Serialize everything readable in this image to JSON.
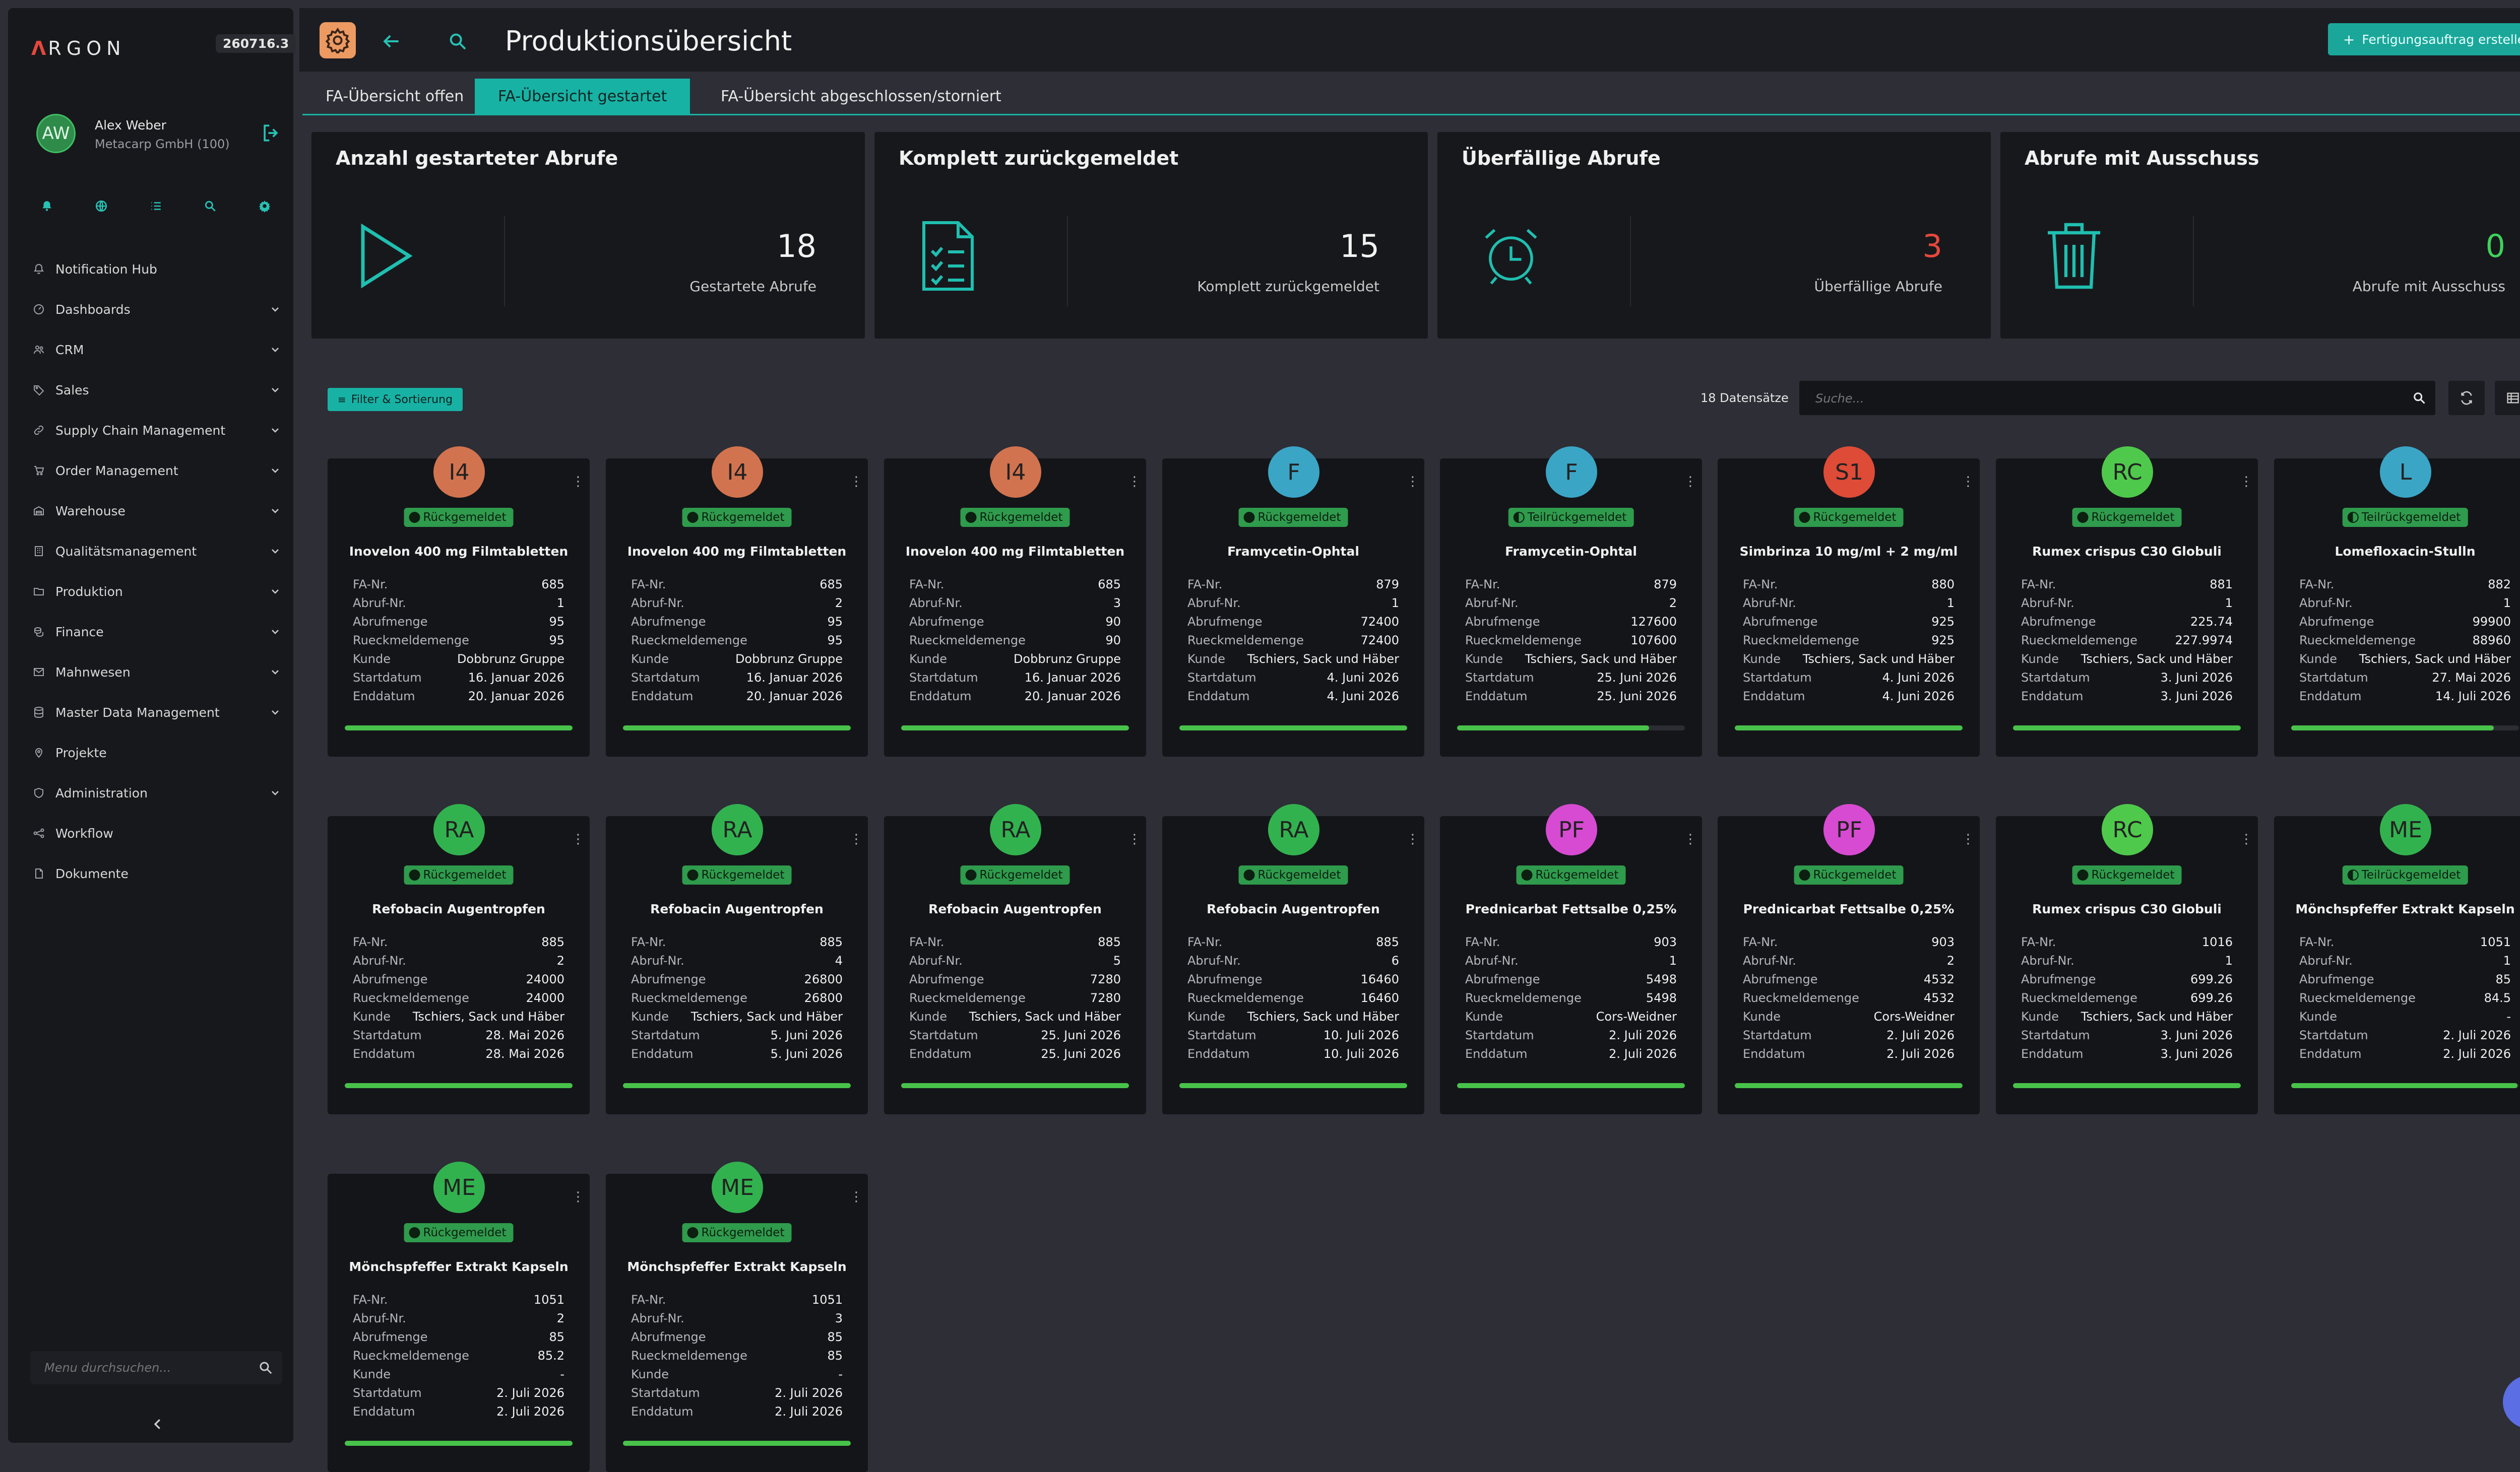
{
  "app": {
    "logo_symbol": "Λ",
    "logo_text": "RGON",
    "version": "260716.3"
  },
  "user": {
    "initials": "AW",
    "name": "Alex Weber",
    "company": "Metacarp GmbH (100)"
  },
  "quick_icons": [
    "bell-icon",
    "globe-icon",
    "list-icon",
    "search-icon",
    "gear-icon"
  ],
  "nav": [
    {
      "label": "Notification Hub",
      "icon": "bell-icon",
      "chevron": false
    },
    {
      "label": "Dashboards",
      "icon": "dashboard-icon",
      "chevron": true
    },
    {
      "label": "CRM",
      "icon": "users-icon",
      "chevron": true
    },
    {
      "label": "Sales",
      "icon": "tag-icon",
      "chevron": true
    },
    {
      "label": "Supply Chain Management",
      "icon": "link-icon",
      "chevron": true
    },
    {
      "label": "Order Management",
      "icon": "cart-icon",
      "chevron": true
    },
    {
      "label": "Warehouse",
      "icon": "warehouse-icon",
      "chevron": true
    },
    {
      "label": "Qualitätsmanagement",
      "icon": "building-icon",
      "chevron": true
    },
    {
      "label": "Produktion",
      "icon": "folder-icon",
      "chevron": true
    },
    {
      "label": "Finance",
      "icon": "coins-icon",
      "chevron": true
    },
    {
      "label": "Mahnwesen",
      "icon": "envelope-icon",
      "chevron": true
    },
    {
      "label": "Master Data Management",
      "icon": "database-icon",
      "chevron": true
    },
    {
      "label": "Projekte",
      "icon": "pin-icon",
      "chevron": false
    },
    {
      "label": "Administration",
      "icon": "shield-icon",
      "chevron": true
    },
    {
      "label": "Workflow",
      "icon": "workflow-icon",
      "chevron": false
    },
    {
      "label": "Dokumente",
      "icon": "document-icon",
      "chevron": false
    }
  ],
  "menu_search": {
    "placeholder": "Menu durchsuchen..."
  },
  "header": {
    "title": "Produktionsübersicht",
    "create_label": "Fertigungsauftrag erstellen"
  },
  "tabs": [
    {
      "label": "FA-Übersicht offen",
      "active": false
    },
    {
      "label": "FA-Übersicht gestartet",
      "active": true
    },
    {
      "label": "FA-Übersicht abgeschlossen/storniert",
      "active": false
    }
  ],
  "kpis": [
    {
      "title": "Anzahl gestarteter Abrufe",
      "value": "18",
      "label": "Gestartete Abrufe",
      "icon": "play-icon",
      "value_color": "#f2f2f2"
    },
    {
      "title": "Komplett zurückgemeldet",
      "value": "15",
      "label": "Komplett zurückgemeldet",
      "icon": "document-checklist-icon",
      "value_color": "#f2f2f2"
    },
    {
      "title": "Überfällige Abrufe",
      "value": "3",
      "label": "Überfällige Abrufe",
      "icon": "alarm-clock-icon",
      "value_color": "#e5483c"
    },
    {
      "title": "Abrufe mit Ausschuss",
      "value": "0",
      "label": "Abrufe mit Ausschuss",
      "icon": "trash-icon",
      "value_color": "#3ed15a"
    }
  ],
  "toolbar": {
    "filter_label": "Filter & Sortierung",
    "count_label": "18 Datensätze",
    "search_placeholder": "Suche..."
  },
  "row_labels": {
    "fa": "FA-Nr.",
    "abruf": "Abruf-Nr.",
    "menge": "Abrufmenge",
    "rueck": "Rueckmeldemenge",
    "kunde": "Kunde",
    "start": "Startdatum",
    "end": "Enddatum"
  },
  "cards": [
    {
      "initials": "I4",
      "status": "Rückgemeldet",
      "name": "Inovelon 400 mg Filmtabletten",
      "fa": "685",
      "abruf": "1",
      "menge": "95",
      "rueck": "95",
      "kunde": "Dobbrunz Gruppe",
      "start": "16. Januar 2026",
      "end": "20. Januar 2026",
      "progress": 1.0
    },
    {
      "initials": "I4",
      "status": "Rückgemeldet",
      "name": "Inovelon 400 mg Filmtabletten",
      "fa": "685",
      "abruf": "2",
      "menge": "95",
      "rueck": "95",
      "kunde": "Dobbrunz Gruppe",
      "start": "16. Januar 2026",
      "end": "20. Januar 2026",
      "progress": 1.0
    },
    {
      "initials": "I4",
      "status": "Rückgemeldet",
      "name": "Inovelon 400 mg Filmtabletten",
      "fa": "685",
      "abruf": "3",
      "menge": "90",
      "rueck": "90",
      "kunde": "Dobbrunz Gruppe",
      "start": "16. Januar 2026",
      "end": "20. Januar 2026",
      "progress": 1.0
    },
    {
      "initials": "F",
      "status": "Rückgemeldet",
      "name": "Framycetin-Ophtal",
      "fa": "879",
      "abruf": "1",
      "menge": "72400",
      "rueck": "72400",
      "kunde": "Tschiers, Sack und Häber",
      "start": "4. Juni 2026",
      "end": "4. Juni 2026",
      "progress": 1.0
    },
    {
      "initials": "F",
      "status": "Teilrückgemeldet",
      "name": "Framycetin-Ophtal",
      "fa": "879",
      "abruf": "2",
      "menge": "127600",
      "rueck": "107600",
      "kunde": "Tschiers, Sack und Häber",
      "start": "25. Juni 2026",
      "end": "25. Juni 2026",
      "progress": 0.843
    },
    {
      "initials": "S1",
      "status": "Rückgemeldet",
      "name": "Simbrinza 10 mg/ml + 2 mg/ml",
      "fa": "880",
      "abruf": "1",
      "menge": "925",
      "rueck": "925",
      "kunde": "Tschiers, Sack und Häber",
      "start": "4. Juni 2026",
      "end": "4. Juni 2026",
      "progress": 1.0
    },
    {
      "initials": "RC",
      "status": "Rückgemeldet",
      "name": "Rumex crispus C30 Globuli",
      "fa": "881",
      "abruf": "1",
      "menge": "225.74",
      "rueck": "227.9974",
      "kunde": "Tschiers, Sack und Häber",
      "start": "3. Juni 2026",
      "end": "3. Juni 2026",
      "progress": 1.0
    },
    {
      "initials": "L",
      "status": "Teilrückgemeldet",
      "name": "Lomefloxacin-Stulln",
      "fa": "882",
      "abruf": "1",
      "menge": "99900",
      "rueck": "88960",
      "kunde": "Tschiers, Sack und Häber",
      "start": "27. Mai 2026",
      "end": "14. Juli 2026",
      "progress": 0.89
    },
    {
      "initials": "RA",
      "status": "Rückgemeldet",
      "name": "Refobacin Augentropfen",
      "fa": "885",
      "abruf": "2",
      "menge": "24000",
      "rueck": "24000",
      "kunde": "Tschiers, Sack und Häber",
      "start": "28. Mai 2026",
      "end": "28. Mai 2026",
      "progress": 1.0
    },
    {
      "initials": "RA",
      "status": "Rückgemeldet",
      "name": "Refobacin Augentropfen",
      "fa": "885",
      "abruf": "4",
      "menge": "26800",
      "rueck": "26800",
      "kunde": "Tschiers, Sack und Häber",
      "start": "5. Juni 2026",
      "end": "5. Juni 2026",
      "progress": 1.0
    },
    {
      "initials": "RA",
      "status": "Rückgemeldet",
      "name": "Refobacin Augentropfen",
      "fa": "885",
      "abruf": "5",
      "menge": "7280",
      "rueck": "7280",
      "kunde": "Tschiers, Sack und Häber",
      "start": "25. Juni 2026",
      "end": "25. Juni 2026",
      "progress": 1.0
    },
    {
      "initials": "RA",
      "status": "Rückgemeldet",
      "name": "Refobacin Augentropfen",
      "fa": "885",
      "abruf": "6",
      "menge": "16460",
      "rueck": "16460",
      "kunde": "Tschiers, Sack und Häber",
      "start": "10. Juli 2026",
      "end": "10. Juli 2026",
      "progress": 1.0
    },
    {
      "initials": "PF",
      "status": "Rückgemeldet",
      "name": "Prednicarbat Fettsalbe 0,25%",
      "fa": "903",
      "abruf": "1",
      "menge": "5498",
      "rueck": "5498",
      "kunde": "Cors-Weidner",
      "start": "2. Juli 2026",
      "end": "2. Juli 2026",
      "progress": 1.0
    },
    {
      "initials": "PF",
      "status": "Rückgemeldet",
      "name": "Prednicarbat Fettsalbe 0,25%",
      "fa": "903",
      "abruf": "2",
      "menge": "4532",
      "rueck": "4532",
      "kunde": "Cors-Weidner",
      "start": "2. Juli 2026",
      "end": "2. Juli 2026",
      "progress": 1.0
    },
    {
      "initials": "RC",
      "status": "Rückgemeldet",
      "name": "Rumex crispus C30 Globuli",
      "fa": "1016",
      "abruf": "1",
      "menge": "699.26",
      "rueck": "699.26",
      "kunde": "Tschiers, Sack und Häber",
      "start": "3. Juni 2026",
      "end": "3. Juni 2026",
      "progress": 1.0
    },
    {
      "initials": "ME",
      "status": "Teilrückgemeldet",
      "name": "Mönchspfeffer Extrakt Kapseln",
      "fa": "1051",
      "abruf": "1",
      "menge": "85",
      "rueck": "84.5",
      "kunde": "-",
      "start": "2. Juli 2026",
      "end": "2. Juli 2026",
      "progress": 0.994
    },
    {
      "initials": "ME",
      "status": "Rückgemeldet",
      "name": "Mönchspfeffer Extrakt Kapseln",
      "fa": "1051",
      "abruf": "2",
      "menge": "85",
      "rueck": "85.2",
      "kunde": "-",
      "start": "2. Juli 2026",
      "end": "2. Juli 2026",
      "progress": 1.0
    },
    {
      "initials": "ME",
      "status": "Rückgemeldet",
      "name": "Mönchspfeffer Extrakt Kapseln",
      "fa": "1051",
      "abruf": "3",
      "menge": "85",
      "rueck": "85",
      "kunde": "-",
      "start": "2. Juli 2026",
      "end": "2. Juli 2026",
      "progress": 1.0
    }
  ]
}
